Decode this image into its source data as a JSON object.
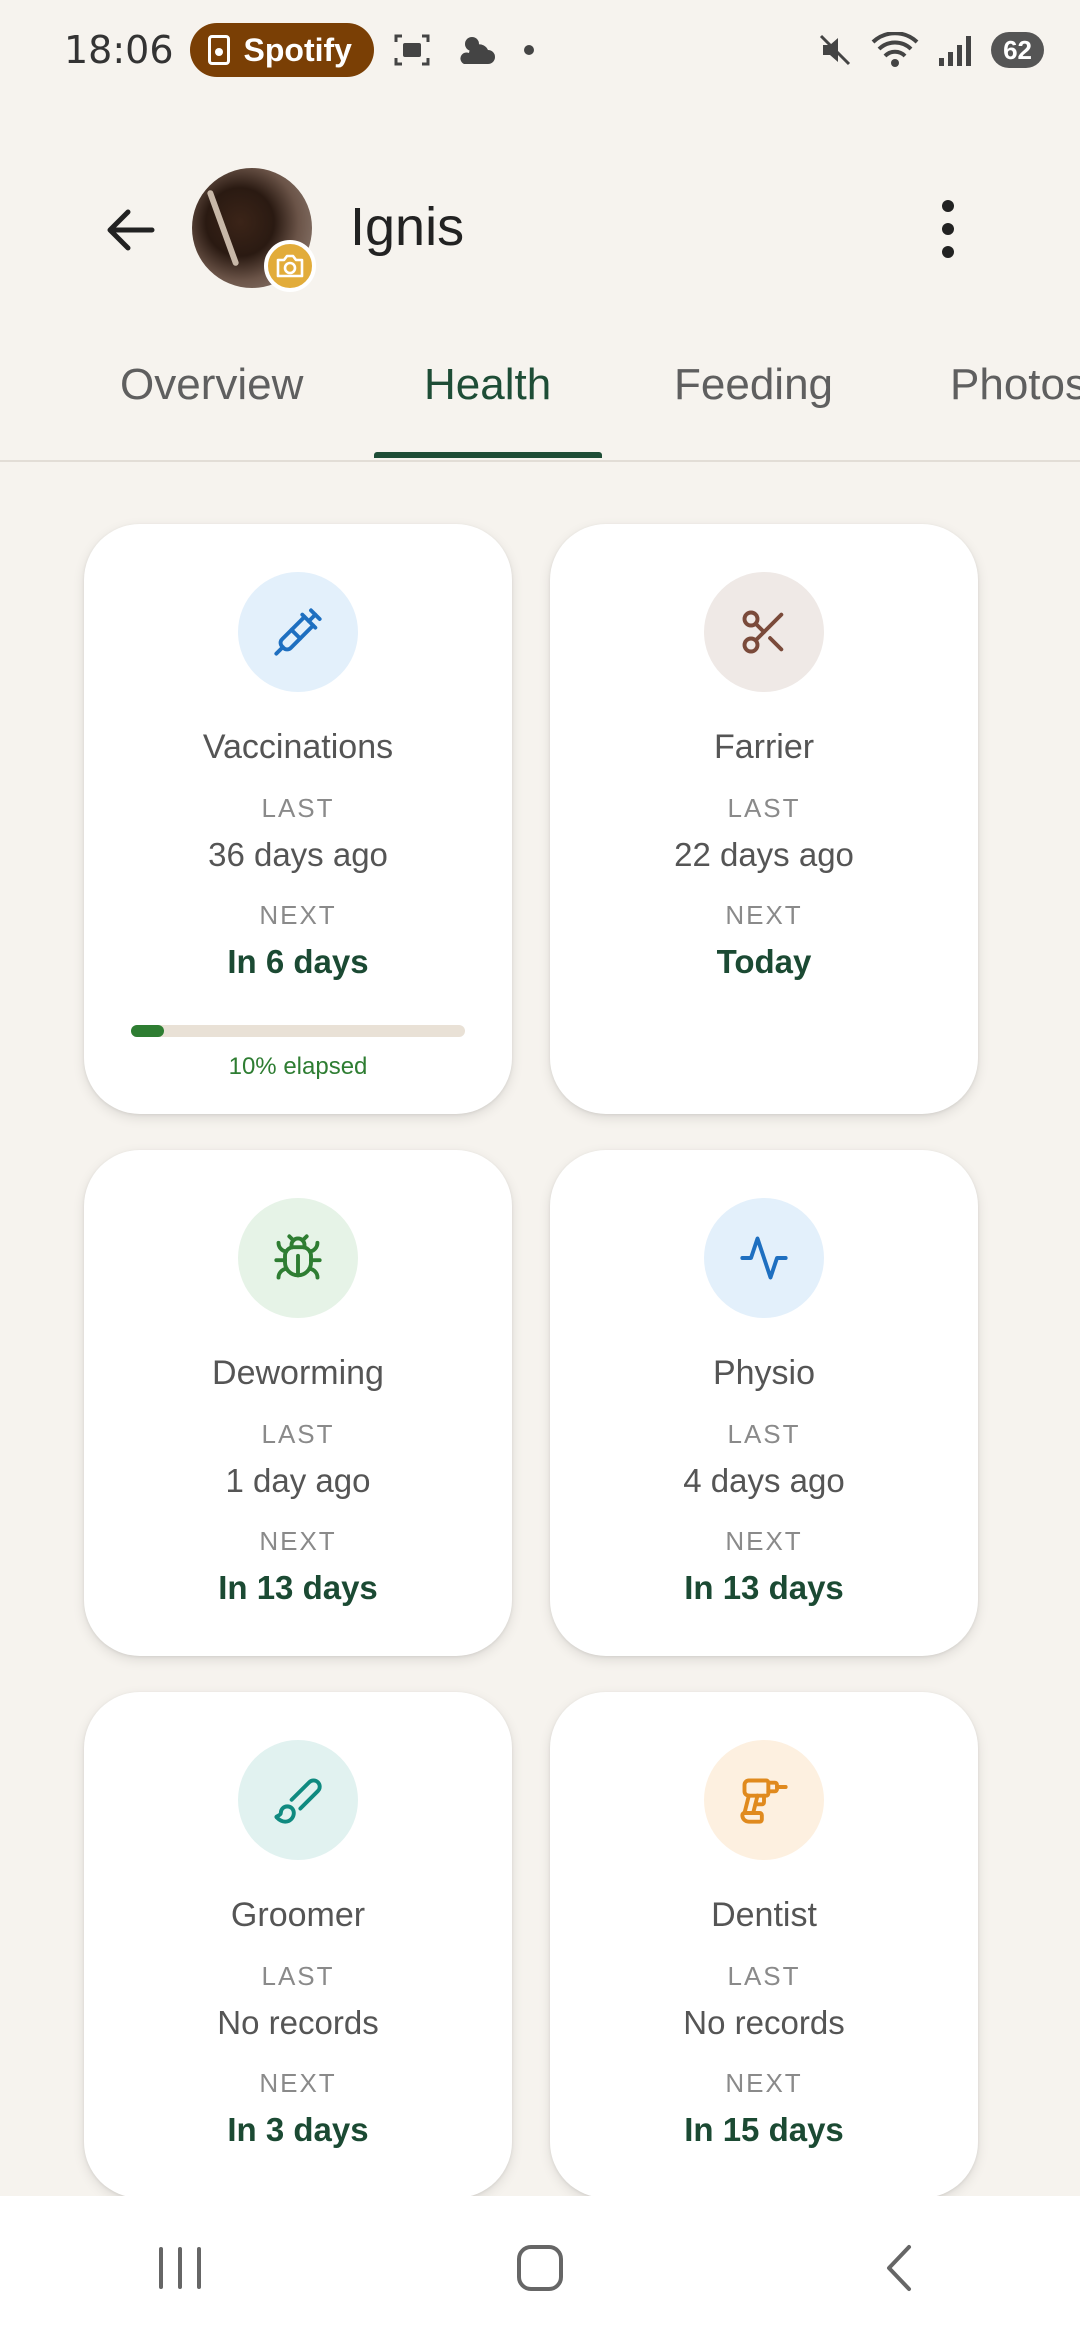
{
  "status_bar": {
    "time": "18:06",
    "notification_app": "Spotify",
    "battery": "62"
  },
  "app_bar": {
    "horse_name": "Ignis"
  },
  "tabs": [
    {
      "label": "Overview",
      "active": false
    },
    {
      "label": "Health",
      "active": true
    },
    {
      "label": "Feeding",
      "active": false
    },
    {
      "label": "Photos",
      "active": false
    }
  ],
  "labels": {
    "last": "LAST",
    "next": "NEXT"
  },
  "cards": [
    {
      "title": "Vaccinations",
      "icon": "syringe-icon",
      "icon_color": "#1e6fc0",
      "icon_bg": "#e3f0fb",
      "last": "36 days ago",
      "next": "In 6 days",
      "progress": 0.1,
      "progress_label": "10% elapsed"
    },
    {
      "title": "Farrier",
      "icon": "scissors-icon",
      "icon_color": "#7a4a3a",
      "icon_bg": "#efe9e6",
      "last": "22 days ago",
      "next": "Today"
    },
    {
      "title": "Deworming",
      "icon": "bug-icon",
      "icon_color": "#2e7d32",
      "icon_bg": "#e6f3e7",
      "last": "1 day ago",
      "next": "In 13 days"
    },
    {
      "title": "Physio",
      "icon": "activity-icon",
      "icon_color": "#1e6fc0",
      "icon_bg": "#e3f0fb",
      "last": "4 days ago",
      "next": "In 13 days"
    },
    {
      "title": "Groomer",
      "icon": "brush-icon",
      "icon_color": "#0f8a80",
      "icon_bg": "#e1f2f0",
      "last": "No records",
      "next": "In 3 days"
    },
    {
      "title": "Dentist",
      "icon": "drill-icon",
      "icon_color": "#e08a1e",
      "icon_bg": "#fdf0e0",
      "last": "No records",
      "next": "In 15 days"
    }
  ]
}
